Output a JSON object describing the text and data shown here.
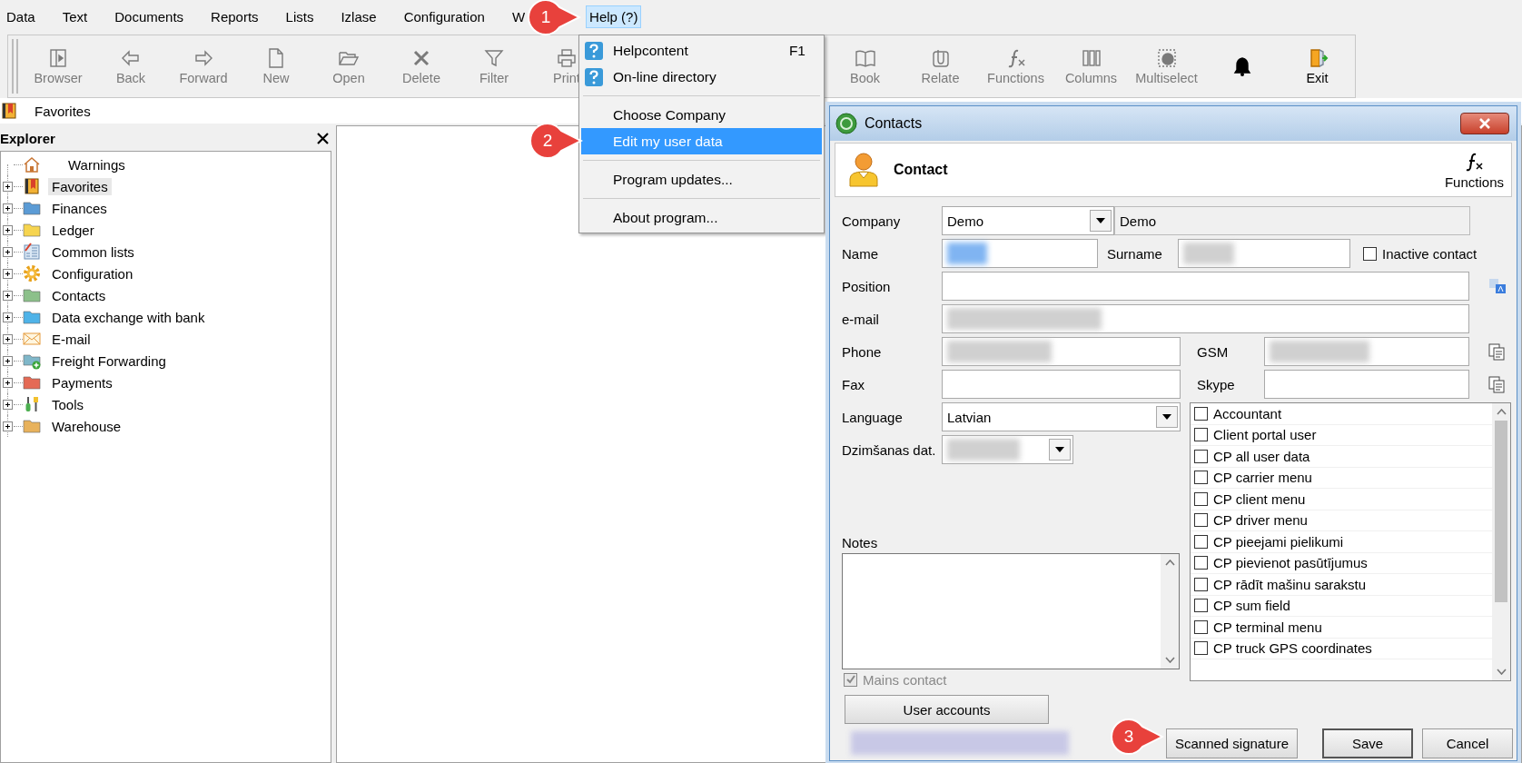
{
  "menu_bar": [
    {
      "label": "Data",
      "selected": false
    },
    {
      "label": "Text",
      "selected": false
    },
    {
      "label": "Documents",
      "selected": false
    },
    {
      "label": "Reports",
      "selected": false
    },
    {
      "label": "Lists",
      "selected": false
    },
    {
      "label": "Izlase",
      "selected": false
    },
    {
      "label": "Configuration",
      "selected": false
    },
    {
      "label": "W",
      "selected": false
    },
    {
      "label": "Help (?)",
      "selected": true
    }
  ],
  "toolbar": [
    {
      "label": "Browser",
      "kind": "browser",
      "disabled": true
    },
    {
      "label": "Back",
      "kind": "back",
      "disabled": true
    },
    {
      "label": "Forward",
      "kind": "forward",
      "disabled": true
    },
    {
      "label": "New",
      "kind": "new",
      "disabled": true
    },
    {
      "label": "Open",
      "kind": "open",
      "disabled": true
    },
    {
      "label": "Delete",
      "kind": "delete",
      "disabled": true
    },
    {
      "label": "Filter",
      "kind": "filter",
      "disabled": true
    },
    {
      "label": "Print",
      "kind": "print",
      "disabled": true
    },
    {
      "label": "Book",
      "kind": "book",
      "disabled": true
    },
    {
      "label": "Relate",
      "kind": "relate",
      "disabled": true
    },
    {
      "label": "Functions",
      "kind": "functions",
      "disabled": true
    },
    {
      "label": "Columns",
      "kind": "columns",
      "disabled": true
    },
    {
      "label": "Multiselect",
      "kind": "multiselect",
      "disabled": true
    },
    {
      "kind": "bell",
      "disabled": false
    },
    {
      "label": "Exit",
      "kind": "exit",
      "disabled": false
    }
  ],
  "favorites_bar": {
    "label": "Favorites"
  },
  "explorer": {
    "title": "Explorer",
    "items": [
      {
        "label": "Warnings",
        "kind": "home",
        "expandable": false,
        "selected": false
      },
      {
        "label": "Favorites",
        "kind": "bookmark",
        "expandable": true,
        "selected": true
      },
      {
        "label": "Finances",
        "kind": "folder",
        "color": "#5b9bd5",
        "expandable": true,
        "selected": false
      },
      {
        "label": "Ledger",
        "kind": "folder",
        "color": "#f6d44f",
        "expandable": true,
        "selected": false
      },
      {
        "label": "Common lists",
        "kind": "list",
        "expandable": true,
        "selected": false
      },
      {
        "label": "Configuration",
        "kind": "gear",
        "expandable": true,
        "selected": false
      },
      {
        "label": "Contacts",
        "kind": "folder",
        "color": "#8cc08a",
        "expandable": true,
        "selected": false
      },
      {
        "label": "Data exchange with bank",
        "kind": "folder",
        "color": "#4fb3e8",
        "expandable": true,
        "selected": false
      },
      {
        "label": "E-mail",
        "kind": "mail",
        "expandable": true,
        "selected": false
      },
      {
        "label": "Freight Forwarding",
        "kind": "folder-add",
        "color": "#7fb7c9",
        "expandable": true,
        "selected": false
      },
      {
        "label": "Payments",
        "kind": "folder",
        "color": "#e46a55",
        "expandable": true,
        "selected": false
      },
      {
        "label": "Tools",
        "kind": "tools",
        "expandable": true,
        "selected": false
      },
      {
        "label": "Warehouse",
        "kind": "folder",
        "color": "#e8b25c",
        "expandable": true,
        "selected": false
      }
    ]
  },
  "help_menu": [
    {
      "kind": "help-item",
      "label": "Helpcontent",
      "shortcut": "F1",
      "selected": false
    },
    {
      "kind": "help-item",
      "label": "On-line directory",
      "selected": false
    },
    {
      "kind": "separator"
    },
    {
      "kind": "item",
      "label": "Choose Company",
      "selected": false
    },
    {
      "kind": "item",
      "label": "Edit my user data",
      "selected": true
    },
    {
      "kind": "separator"
    },
    {
      "kind": "item",
      "label": "Program updates...",
      "selected": false
    },
    {
      "kind": "separator"
    },
    {
      "kind": "item",
      "label": "About program...",
      "selected": false
    }
  ],
  "dialog": {
    "title": "Contacts",
    "header_title": "Contact",
    "functions_label": "Functions",
    "company": {
      "label": "Company",
      "value": "Demo",
      "name_value": "Demo"
    },
    "name": {
      "label": "Name"
    },
    "surname": {
      "label": "Surname"
    },
    "inactive_contact": {
      "label": "Inactive contact",
      "checked": false
    },
    "position": {
      "label": "Position"
    },
    "email": {
      "label": "e-mail"
    },
    "phone": {
      "label": "Phone"
    },
    "gsm": {
      "label": "GSM"
    },
    "fax": {
      "label": "Fax"
    },
    "skype": {
      "label": "Skype"
    },
    "language": {
      "label": "Language",
      "value": "Latvian"
    },
    "birth_date": {
      "label": "Dzimšanas dat."
    },
    "notes": {
      "label": "Notes"
    },
    "main_contact": {
      "label": "Mains contact",
      "checked": true,
      "disabled": true
    },
    "roles": [
      {
        "label": "Accountant",
        "checked": false
      },
      {
        "label": "Client portal user",
        "checked": false
      },
      {
        "label": "CP all user data",
        "checked": false
      },
      {
        "label": "CP carrier menu",
        "checked": false
      },
      {
        "label": "CP client menu",
        "checked": false
      },
      {
        "label": "CP driver menu",
        "checked": false
      },
      {
        "label": "CP pieejami pielikumi",
        "checked": false
      },
      {
        "label": "CP pievienot pasūtījumus",
        "checked": false
      },
      {
        "label": "CP rādīt mašinu sarakstu",
        "checked": false
      },
      {
        "label": "CP sum field",
        "checked": false
      },
      {
        "label": "CP terminal menu",
        "checked": false
      },
      {
        "label": "CP truck GPS coordinates",
        "checked": false
      }
    ],
    "user_accounts_button": "User accounts",
    "buttons": [
      {
        "label": "Scanned signature",
        "default": false
      },
      {
        "label": "Save",
        "default": true
      },
      {
        "label": "Cancel",
        "default": false
      }
    ]
  },
  "callouts": [
    {
      "number": "1"
    },
    {
      "number": "2"
    },
    {
      "number": "3"
    }
  ]
}
